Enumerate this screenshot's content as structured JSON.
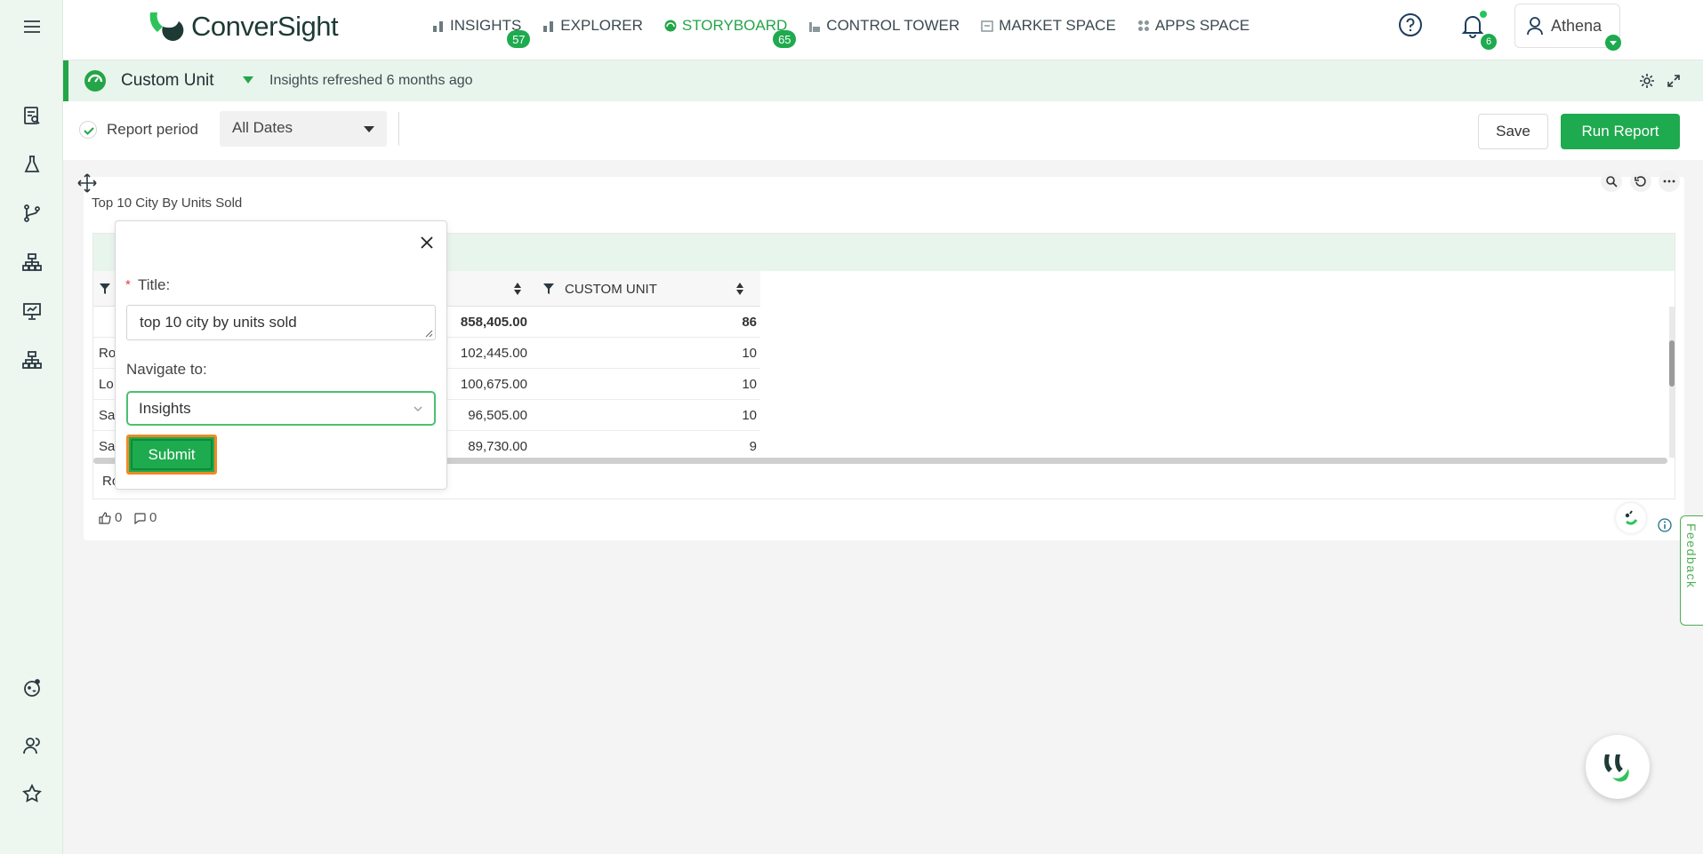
{
  "app": {
    "logo_text": "ConverSight",
    "brand_color": "#1eaa4e",
    "accent_highlight": "#f08a24"
  },
  "nav": {
    "items": [
      {
        "label": "INSIGHTS",
        "icon": "bar-chart-icon",
        "badge": "57",
        "active": false
      },
      {
        "label": "EXPLORER",
        "icon": "bar-chart-icon",
        "badge": "",
        "active": false
      },
      {
        "label": "STORYBOARD",
        "icon": "storyboard-icon",
        "badge": "65",
        "active": true
      },
      {
        "label": "CONTROL TOWER",
        "icon": "tower-icon",
        "badge": "",
        "active": false
      },
      {
        "label": "MARKET SPACE",
        "icon": "market-icon",
        "badge": "",
        "active": false
      },
      {
        "label": "APPS SPACE",
        "icon": "apps-grid-icon",
        "badge": "",
        "active": false
      }
    ],
    "notifications_count": "6",
    "user_name": "Athena"
  },
  "sidebar": {
    "items": [
      "menu-icon",
      "report-icon",
      "lab-flask-icon",
      "branch-icon",
      "hierarchy-icon",
      "presentation-icon",
      "org-chart-icon",
      "assistant-icon",
      "users-icon",
      "star-icon"
    ]
  },
  "subheader": {
    "title": "Custom Unit",
    "refresh_text": "Insights refreshed 6 months ago"
  },
  "filters": {
    "report_period_label": "Report period",
    "date_value": "All Dates",
    "save_label": "Save",
    "run_label": "Run Report"
  },
  "card": {
    "title": "Top 10 City By Units Sold",
    "table": {
      "col2_header": "CUSTOM UNIT",
      "rows": [
        {
          "left": "",
          "value": "858,405.00",
          "unit": "86",
          "bold": true
        },
        {
          "left": "Ro",
          "value": "102,445.00",
          "unit": "10",
          "bold": false
        },
        {
          "left": "Lo",
          "value": "100,675.00",
          "unit": "10",
          "bold": false
        },
        {
          "left": "Sa",
          "value": "96,505.00",
          "unit": "10",
          "bold": false
        },
        {
          "left": "Sa",
          "value": "89,730.00",
          "unit": "9",
          "bold": false
        }
      ],
      "footer_text": "Ro"
    },
    "likes": "0",
    "comments": "0"
  },
  "popup": {
    "title_label": "Title:",
    "title_value": "top 10 city by units sold",
    "navigate_label": "Navigate to:",
    "navigate_value": "Insights",
    "submit_label": "Submit"
  },
  "feedback_label": "Feedback"
}
